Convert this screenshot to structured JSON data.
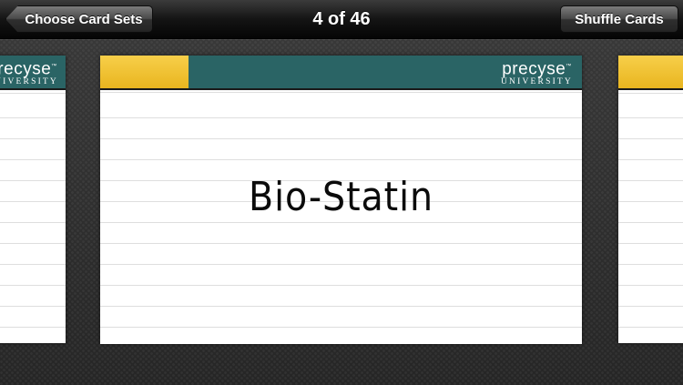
{
  "nav": {
    "back_label": "Choose Card Sets",
    "position_label": "4 of 46",
    "shuffle_label": "Shuffle Cards"
  },
  "card": {
    "term": "Bio-Statin",
    "logo_main": "precyse",
    "logo_tm": "™",
    "logo_sub": "UNIVERSITY"
  },
  "colors": {
    "header_teal": "#2a6465",
    "header_yellow": "#e9b51f",
    "toolbar": "#141414"
  },
  "icons": {
    "back": "chevron-left-icon"
  }
}
